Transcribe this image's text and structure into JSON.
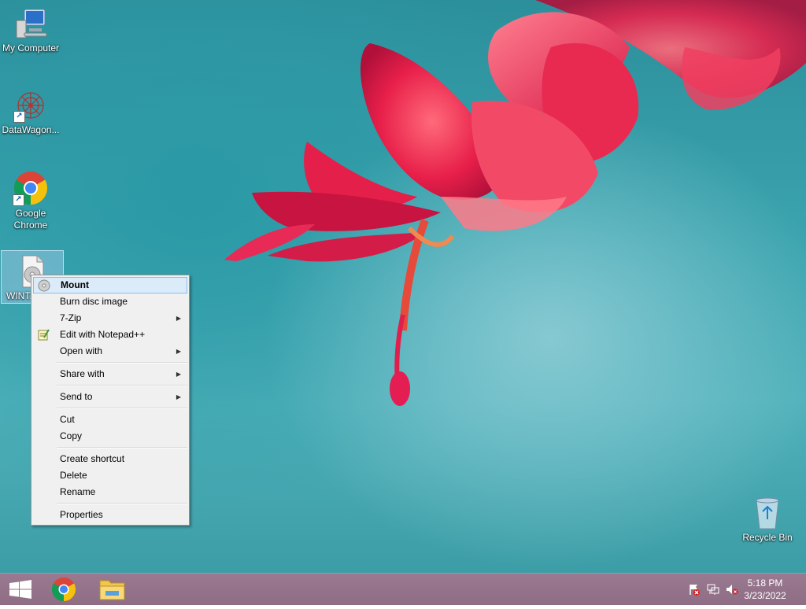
{
  "desktop": {
    "icons": [
      {
        "label": "My Computer"
      },
      {
        "label": "DataWagon..."
      },
      {
        "label": "Google Chrome"
      },
      {
        "label": "WINT..."
      },
      {
        "label": "Recycle Bin"
      }
    ]
  },
  "context_menu": {
    "items": [
      {
        "label": "Mount"
      },
      {
        "label": "Burn disc image"
      },
      {
        "label": "7-Zip"
      },
      {
        "label": "Edit with Notepad++"
      },
      {
        "label": "Open with"
      },
      {
        "label": "Share with"
      },
      {
        "label": "Send to"
      },
      {
        "label": "Cut"
      },
      {
        "label": "Copy"
      },
      {
        "label": "Create shortcut"
      },
      {
        "label": "Delete"
      },
      {
        "label": "Rename"
      },
      {
        "label": "Properties"
      }
    ]
  },
  "taskbar": {
    "clock": {
      "time": "5:18 PM",
      "date": "3/23/2022"
    }
  },
  "colors": {
    "taskbar": "#8e6d85",
    "menu_highlight": "#dcebf9",
    "desktop_teal": "#2c8f9b"
  }
}
